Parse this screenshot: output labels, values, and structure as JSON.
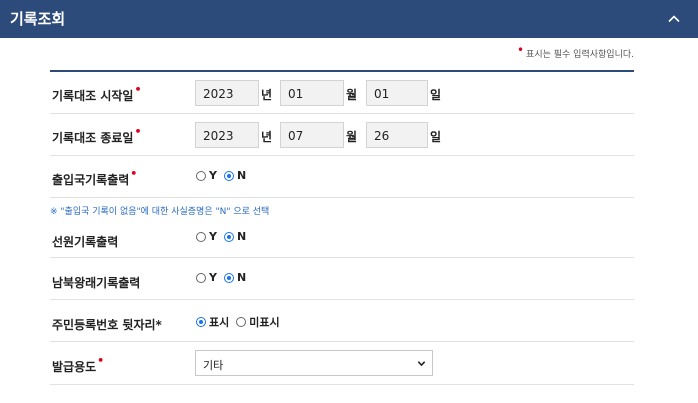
{
  "header": {
    "title": "기록조회"
  },
  "required_note": "표시는 필수 입력사항입니다.",
  "start": {
    "label": "기록대조 시작일",
    "year": "2023",
    "month": "01",
    "day": "01"
  },
  "end": {
    "label": "기록대조 종료일",
    "year": "2023",
    "month": "07",
    "day": "26"
  },
  "units": {
    "year": "년",
    "month": "월",
    "day": "일"
  },
  "immigration": {
    "label": "출입국기록출력",
    "opt_y": "Y",
    "opt_n": "N",
    "selected": "N"
  },
  "immigration_note": "※ \"출입국 기록이 없음\"에 대한 사실증명은 \"N\" 으로 선택",
  "seaman": {
    "label": "선원기록출력",
    "opt_y": "Y",
    "opt_n": "N",
    "selected": "N"
  },
  "interkorean": {
    "label": "남북왕래기록출력",
    "opt_y": "Y",
    "opt_n": "N",
    "selected": "N"
  },
  "rrn_suffix": {
    "label": "주민등록번호 뒷자리*",
    "opt_show": "표시",
    "opt_hide": "미표시",
    "selected": "표시"
  },
  "purpose": {
    "label": "발급용도",
    "value": "기타"
  },
  "colors": {
    "header_bg": "#2c4a7a",
    "required_star": "#e0001b",
    "note_text": "#2a6bc4",
    "radio_selected": "#1a73e8"
  }
}
